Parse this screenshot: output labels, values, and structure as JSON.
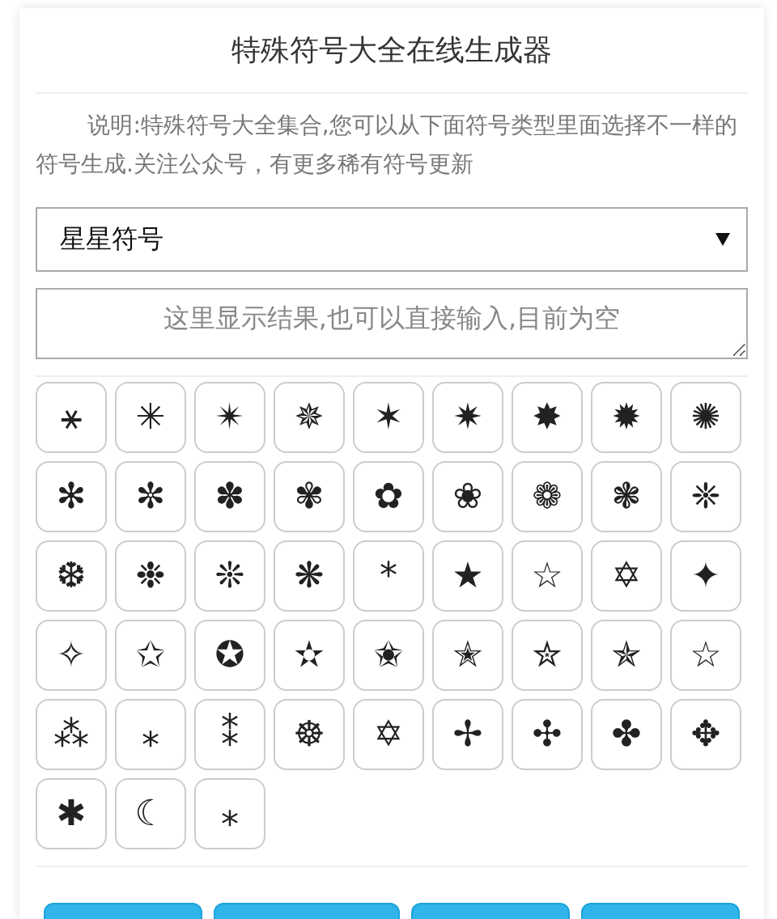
{
  "title": "特殊符号大全在线生成器",
  "description": "说明:特殊符号大全集合,您可以从下面符号类型里面选择不一样的符号生成.关注公众号，有更多稀有符号更新",
  "category_select": {
    "value": "星星符号"
  },
  "result_box": {
    "placeholder": "这里显示结果,也可以直接输入,目前为空"
  },
  "symbols": [
    "⚹",
    "✳",
    "✴",
    "✵",
    "✶",
    "✷",
    "✸",
    "✹",
    "✺",
    "✻",
    "✼",
    "✽",
    "✾",
    "✿",
    "❀",
    "❁",
    "❃",
    "❈",
    "❆",
    "❉",
    "❊",
    "❋",
    "*",
    "★",
    "☆",
    "✡",
    "✦",
    "✧",
    "✩",
    "✪",
    "✫",
    "✬",
    "✭",
    "✮",
    "✯",
    "☆",
    "⁂",
    "⁎",
    "⁑",
    "☸",
    "✡",
    "✢",
    "✣",
    "✤",
    "✥",
    "✱",
    "☾",
    "⁎"
  ],
  "action_buttons": [
    {
      "kind": "button"
    },
    {
      "kind": "button"
    },
    {
      "kind": "button"
    },
    {
      "kind": "button"
    }
  ]
}
